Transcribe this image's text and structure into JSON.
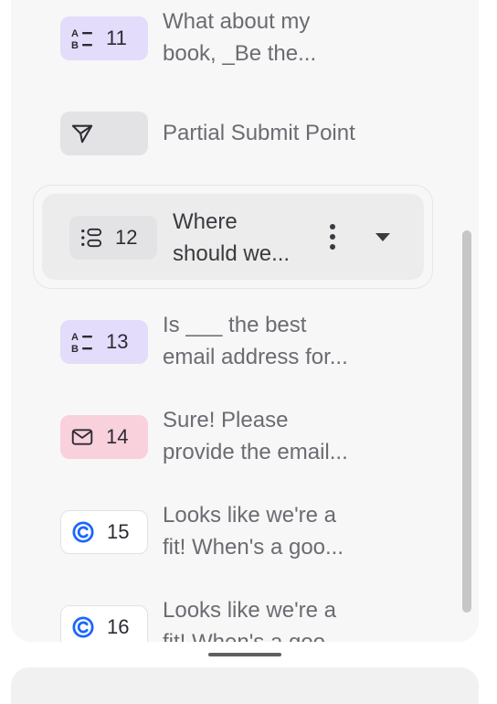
{
  "questions": [
    {
      "num": "11",
      "icon": "multiple-choice-icon",
      "line1": "What about my",
      "line2": "book, _Be the..."
    },
    {
      "num": "",
      "icon": "send-icon",
      "line1": "Partial Submit Point",
      "line2": ""
    },
    {
      "num": "12",
      "icon": "ranking-list-icon",
      "line1": "Where",
      "line2": "should we..."
    },
    {
      "num": "13",
      "icon": "multiple-choice-icon",
      "line1": "Is ___ the best",
      "line2": "email address for..."
    },
    {
      "num": "14",
      "icon": "email-icon",
      "line1": "Sure! Please",
      "line2": "provide the email..."
    },
    {
      "num": "15",
      "icon": "calendly-icon",
      "line1": "Looks like we're a",
      "line2": "fit! When's a goo..."
    },
    {
      "num": "16",
      "icon": "calendly-icon",
      "line1": "Looks like we're a",
      "line2": "fit! When's a goo..."
    }
  ],
  "colors": {
    "multiple_choice_badge": "#e4dcfb",
    "statement_badge": "#e3e3e6",
    "email_badge": "#f8d1dd",
    "calendly_badge": "#ffffff",
    "calendly_blue": "#1a66ff"
  }
}
